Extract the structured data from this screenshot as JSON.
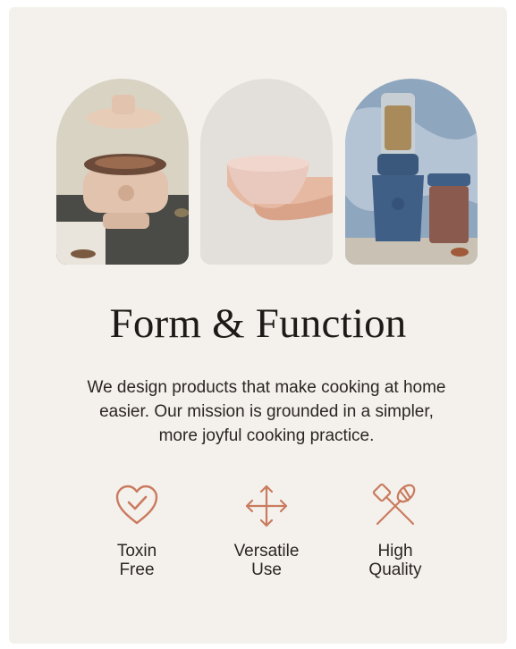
{
  "section": {
    "heading": "Form & Function",
    "description": "We design products that make cooking at home easier. Our mission is grounded in a simpler, more joyful cooking practice."
  },
  "images": [
    {
      "icon": "pot-with-lid-photo"
    },
    {
      "icon": "hand-holding-bowl-photo"
    },
    {
      "icon": "blender-and-jar-photo"
    }
  ],
  "features": [
    {
      "label": "Toxin\nFree",
      "icon": "heart-check-icon"
    },
    {
      "label": "Versatile\nUse",
      "icon": "four-way-arrows-icon"
    },
    {
      "label": "High\nQuality",
      "icon": "spatula-whisk-icon"
    }
  ],
  "colors": {
    "background": "#f4f1ec",
    "accent": "#c97b5f",
    "text": "#1e1a17"
  }
}
